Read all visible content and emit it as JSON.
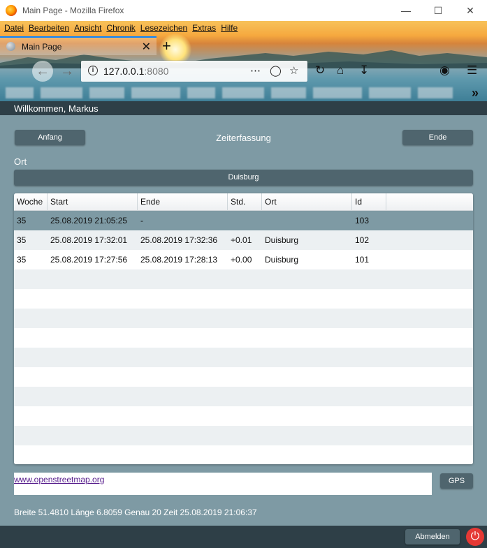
{
  "window": {
    "title": "Main Page - Mozilla Firefox"
  },
  "menu": [
    "Datei",
    "Bearbeiten",
    "Ansicht",
    "Chronik",
    "Lesezeichen",
    "Extras",
    "Hilfe"
  ],
  "tab": {
    "title": "Main Page",
    "close": "✕",
    "new": "+"
  },
  "address": {
    "host": "127.0.0.1",
    "port": ":8080"
  },
  "header": {
    "welcome": "Willkommen, Markus"
  },
  "toolbar": {
    "start_label": "Anfang",
    "title": "Zeiterfassung",
    "end_label": "Ende"
  },
  "location": {
    "label": "Ort",
    "value": "Duisburg"
  },
  "table": {
    "columns": [
      "Woche",
      "Start",
      "Ende",
      "Std.",
      "Ort",
      "Id"
    ],
    "rows": [
      [
        "35",
        "25.08.2019 21:05:25",
        "-",
        "",
        "",
        "103"
      ],
      [
        "35",
        "25.08.2019 17:32:01",
        "25.08.2019 17:32:36",
        "+0.01",
        "Duisburg",
        "102"
      ],
      [
        "35",
        "25.08.2019 17:27:56",
        "25.08.2019 17:28:13",
        "+0.00",
        "Duisburg",
        "101"
      ]
    ]
  },
  "map": {
    "link_text": "www.openstreetmap.org"
  },
  "gps": {
    "label": "GPS"
  },
  "status": {
    "text": "Breite 51.4810 Länge 6.8059 Genau 20 Zeit 25.08.2019 21:06:37"
  },
  "footer": {
    "logout_label": "Abmelden"
  },
  "colors": {
    "app_bg": "#7e9aa4",
    "dark_bar": "#2e3f47",
    "button": "#4f656e",
    "selected_row": "#7e9aa4",
    "alt_row": "#ecf0f2"
  }
}
